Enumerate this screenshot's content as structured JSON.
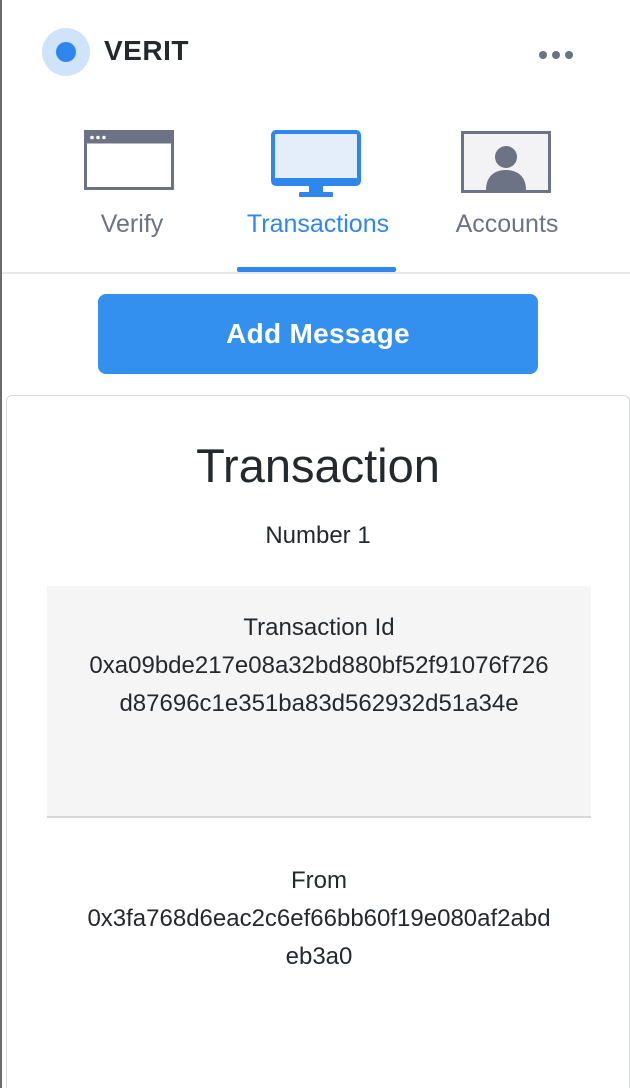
{
  "header": {
    "brand": "VERIT",
    "logo_icon": "circle-logo-icon",
    "menu_icon": "more-horizontal-icon"
  },
  "tabs": [
    {
      "label": "Verify",
      "icon": "browser-window-icon",
      "active": false
    },
    {
      "label": "Transactions",
      "icon": "monitor-icon",
      "active": true
    },
    {
      "label": "Accounts",
      "icon": "user-card-icon",
      "active": false
    }
  ],
  "actions": {
    "add_message_label": "Add Message"
  },
  "transaction": {
    "title": "Transaction",
    "number": "Number 1",
    "id_label": "Transaction Id",
    "id_value": "0xa09bde217e08a32bd880bf52f91076f726d87696c1e351ba83d562932d51a34e",
    "from_label": "From",
    "from_value": "0x3fa768d6eac2c6ef66bb60f19e080af2abdeb3a0"
  },
  "colors": {
    "accent": "#2f86ee",
    "inactive": "#6b7384",
    "text": "#24292e"
  }
}
